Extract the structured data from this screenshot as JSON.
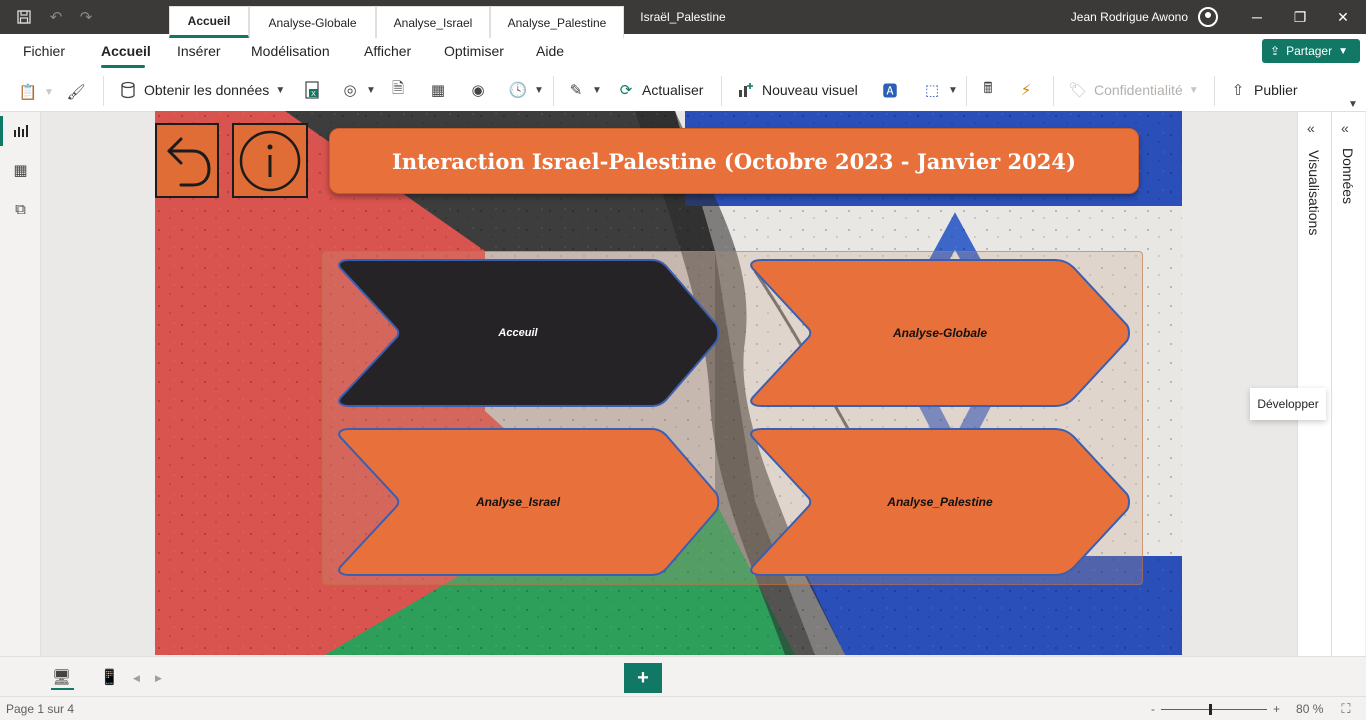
{
  "window": {
    "title": "Israël_Palestine",
    "user": "Jean Rodrigue Awono"
  },
  "menu": {
    "items": [
      "Fichier",
      "Accueil",
      "Insérer",
      "Modélisation",
      "Afficher",
      "Optimiser",
      "Aide"
    ],
    "active": "Accueil",
    "share_label": "Partager"
  },
  "ribbon": {
    "get_data": "Obtenir les données",
    "refresh": "Actualiser",
    "new_visual": "Nouveau visuel",
    "sensitivity": "Confidentialité",
    "publish": "Publier"
  },
  "report": {
    "title": "Interaction Israel-Palestine (Octobre 2023 - Janvier 2024)",
    "nav_buttons": [
      "Acceuil",
      "Analyse-Globale",
      "Analyse_Israel",
      "Analyse_Palestine"
    ],
    "colors": {
      "accent": "#e8703a",
      "dark_button": "#252325",
      "palestine_red": "#d9534f",
      "palestine_green": "#2e9e5b",
      "israel_blue": "#2a4fb8"
    }
  },
  "right_panes": {
    "visualizations": "Visualisations",
    "data": "Données",
    "tooltip": "Développer"
  },
  "pages": {
    "tabs": [
      "Accueil",
      "Analyse-Globale",
      "Analyse_Israel",
      "Analyse_Palestine"
    ],
    "active": "Accueil",
    "add": "+"
  },
  "status": {
    "page_info": "Page 1 sur 4",
    "zoom": "80 %"
  }
}
